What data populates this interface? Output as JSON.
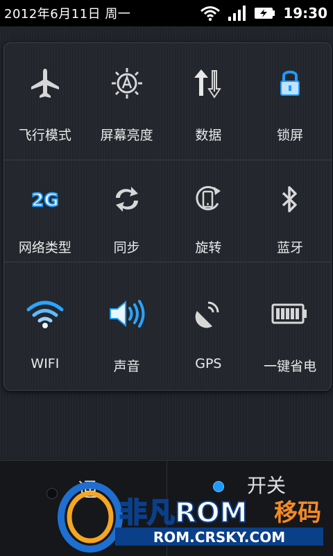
{
  "status_bar": {
    "date": "2012年6月11日 周一",
    "time": "19:30",
    "icons": [
      "wifi-icon",
      "signal-icon",
      "battery-charging-icon"
    ]
  },
  "toggles": {
    "row1": [
      {
        "label": "飞行模式",
        "icon": "airplane-icon"
      },
      {
        "label": "屏幕亮度",
        "icon": "brightness-auto-icon"
      },
      {
        "label": "数据",
        "icon": "data-arrows-icon"
      },
      {
        "label": "锁屏",
        "icon": "lock-icon"
      }
    ],
    "row2": [
      {
        "label": "网络类型",
        "icon": "network-2g-icon",
        "badge": "2G"
      },
      {
        "label": "同步",
        "icon": "sync-icon"
      },
      {
        "label": "旋转",
        "icon": "rotate-icon"
      },
      {
        "label": "蓝牙",
        "icon": "bluetooth-icon"
      }
    ],
    "row3": [
      {
        "label": "WIFI",
        "icon": "wifi-icon"
      },
      {
        "label": "声音",
        "icon": "speaker-icon"
      },
      {
        "label": "GPS",
        "icon": "gps-icon"
      },
      {
        "label": "一键省电",
        "icon": "battery-icon"
      }
    ]
  },
  "lower_strip": {
    "left_text": "通",
    "right_text": "开关"
  },
  "watermark": {
    "brand": "非凡ROM",
    "suffix": "移码",
    "url": "ROM.CRSKY.COM"
  },
  "colors": {
    "accent_blue": "#1e9bff",
    "icon_gray": "#d7d7d7"
  }
}
